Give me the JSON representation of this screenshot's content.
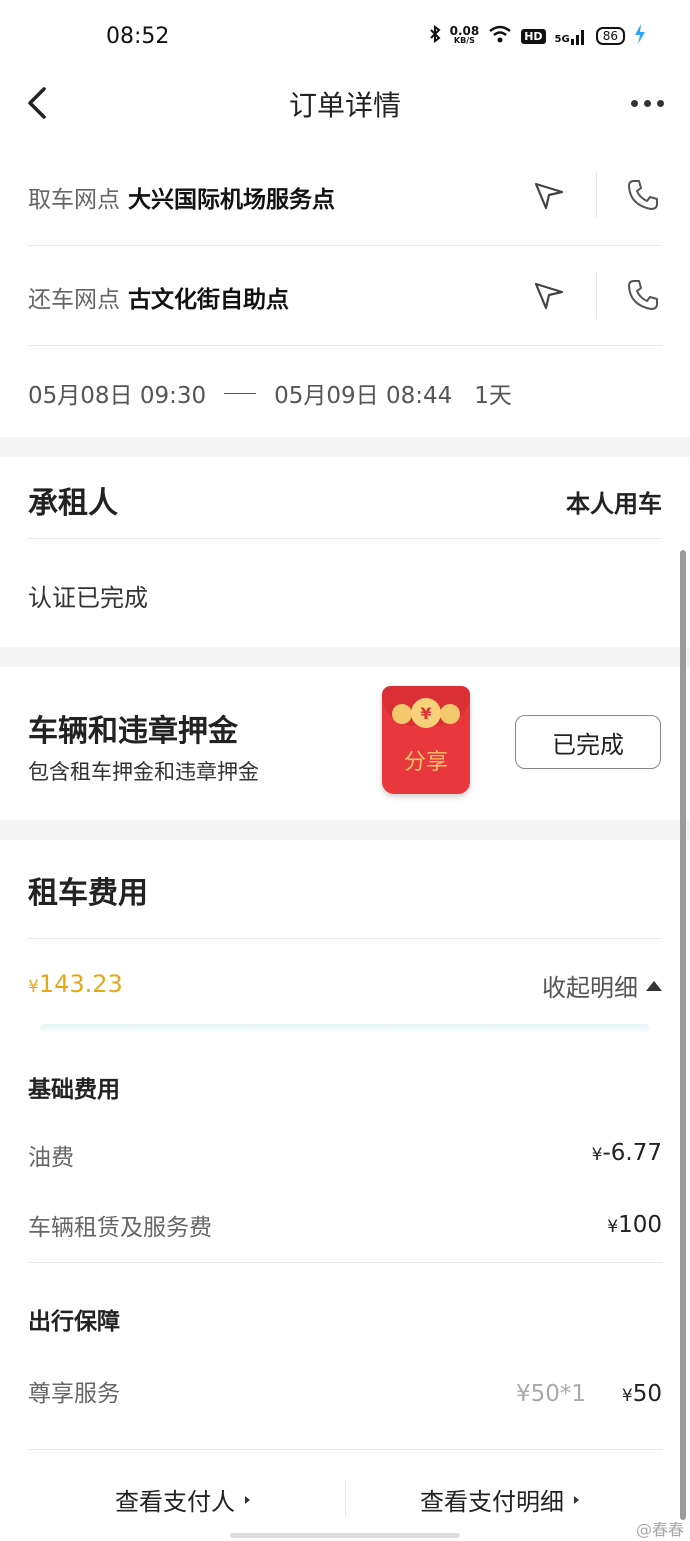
{
  "status_bar": {
    "time": "08:52",
    "net_speed": "0.08",
    "net_unit": "KB/S",
    "hd": "HD",
    "signal": "5G",
    "battery": "86"
  },
  "header": {
    "title": "订单详情"
  },
  "pickup": {
    "label": "取车网点",
    "value": "大兴国际机场服务点"
  },
  "return": {
    "label": "还车网点",
    "value": "古文化街自助点"
  },
  "rental_period": {
    "start": "05月08日 09:30",
    "end": "05月09日 08:44",
    "duration": "1天"
  },
  "lessee": {
    "title": "承租人",
    "type": "本人用车",
    "status": "认证已完成"
  },
  "deposit": {
    "title": "车辆和违章押金",
    "subtitle": "包含租车押金和违章押金",
    "button": "已完成",
    "share_label": "分享",
    "share_coin": "¥"
  },
  "fees": {
    "title": "租车费用",
    "currency": "¥",
    "total": "143.23",
    "toggle": "收起明细",
    "basic": {
      "title": "基础费用",
      "items": [
        {
          "label": "油费",
          "currency": "¥",
          "value": "-6.77"
        },
        {
          "label": "车辆租赁及服务费",
          "currency": "¥",
          "value": "100"
        }
      ]
    },
    "protection": {
      "title": "出行保障",
      "items": [
        {
          "label": "尊享服务",
          "unit": "¥50*1",
          "currency": "¥",
          "value": "50"
        }
      ]
    }
  },
  "footer": {
    "payer_link": "查看支付人",
    "details_link": "查看支付明细"
  },
  "watermark": "@春春",
  "colors": {
    "accent_price": "#e6a817",
    "share_red": "#e8383d",
    "divider": "#e9e9e9",
    "band": "#f5f5f5"
  }
}
